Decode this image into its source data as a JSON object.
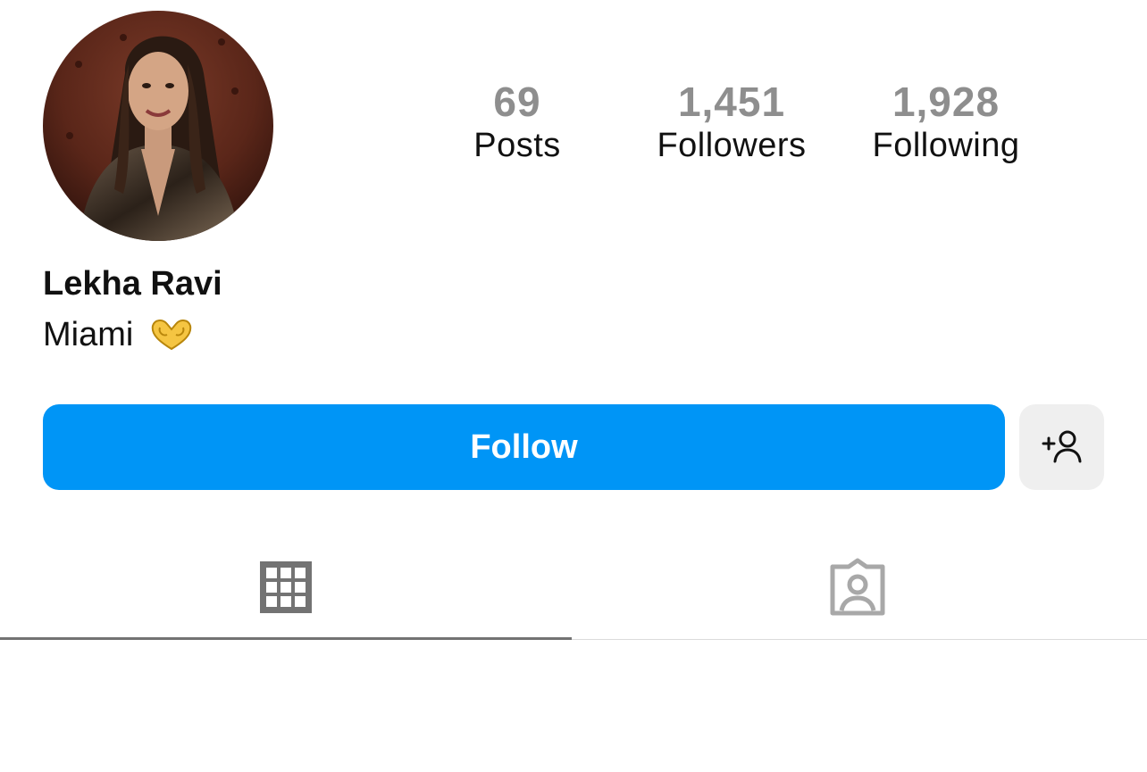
{
  "profile": {
    "name": "Lekha Ravi",
    "bio": "Miami",
    "bio_emoji": "heart-hands-emoji",
    "avatar": "profile-photo"
  },
  "stats": {
    "posts": {
      "value": "69",
      "label": "Posts"
    },
    "followers": {
      "value": "1,451",
      "label": "Followers"
    },
    "following": {
      "value": "1,928",
      "label": "Following"
    }
  },
  "actions": {
    "follow_label": "Follow",
    "suggest_icon": "add-person-icon"
  },
  "tabs": [
    {
      "icon": "grid-icon",
      "active": true
    },
    {
      "icon": "tagged-person-icon",
      "active": false
    }
  ],
  "colors": {
    "accent": "#0095f6",
    "secondary_button_bg": "#efefef",
    "muted_text": "#8e8e8e",
    "icon_gray": "#737373"
  }
}
